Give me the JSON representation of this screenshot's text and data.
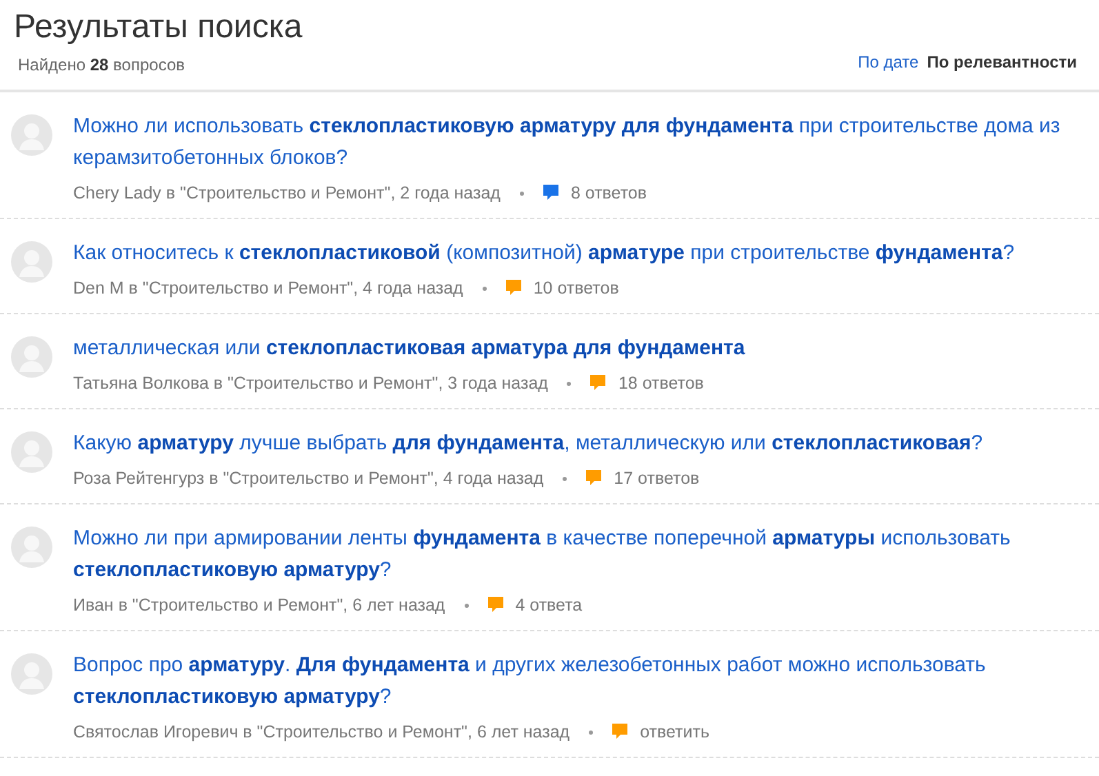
{
  "header": {
    "title": "Результаты поиска",
    "found": "Найдено **28** вопросов",
    "sort_options": [
      {
        "label": "По дате",
        "selected": false
      },
      {
        "label": "По релевантности",
        "selected": true
      }
    ]
  },
  "questions": [
    {
      "text": "Можно ли использовать **стеклопластиковую арматуру для фундамента** при строительстве дома из керамзитобетонных блоков?",
      "meta": "Chery Lady в \"Строительство и Ремонт\", 2 года назад",
      "answers": "8 ответов",
      "color": "#1a73e8"
    },
    {
      "text": "Как относитесь к **стеклопластиковой** (композитной) **арматуре** при строительстве **фундамента**?",
      "meta": "Den M в \"Строительство и Ремонт\", 4 года назад",
      "answers": "10 ответов",
      "color": "#ff9c00"
    },
    {
      "text": "металлическая или **стеклопластиковая арматура для фундамента**",
      "meta": "Татьяна Волкова в \"Строительство и Ремонт\", 3 года назад",
      "answers": "18 ответов",
      "color": "#ff9c00"
    },
    {
      "text": "Какую **арматуру** лучше выбрать **для фундамента**, металлическую или **стеклопластиковая**?",
      "meta": "Роза Рейтенгурз в \"Строительство и Ремонт\", 4 года назад",
      "answers": "17 ответов",
      "color": "#ff9c00"
    },
    {
      "text": "Можно ли при армировании ленты **фундамента** в качестве поперечной **арматуры** использовать **стеклопластиковую арматуру**?",
      "meta": "Иван в \"Строительство и Ремонт\", 6 лет назад",
      "answers": "4 ответа",
      "color": "#ff9c00"
    },
    {
      "text": "Вопрос про **арматуру**. **Для фундамента** и других железобетонных работ можно использовать **стеклопластиковую арматуру**?",
      "meta": "Святослав Игоревич в \"Строительство и Ремонт\", 6 лет назад",
      "answers": "ответить",
      "color": "#ff9c00"
    }
  ]
}
